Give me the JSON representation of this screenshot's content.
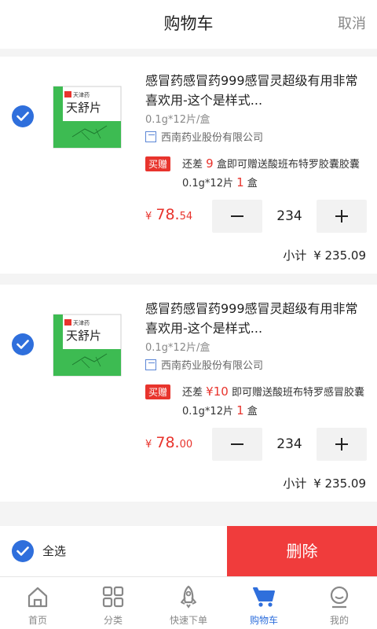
{
  "header": {
    "title": "购物车",
    "cancel": "取消"
  },
  "items": [
    {
      "name": "感冒药感冒药999感冒灵超级有用非常喜欢用-这个是样式...",
      "spec": "0.1g*12片/盒",
      "maker": "西南药业股份有限公司",
      "promo_tag": "买赠",
      "promo_pre": "还差",
      "promo_amount": "9",
      "promo_mid": "盒即可赠送酸班布特罗胶囊胶囊",
      "promo_spec": "0.1g*12片",
      "promo_count": "1",
      "promo_unit": "盒",
      "price_currency": "¥",
      "price_int": "78.",
      "price_dec": "54",
      "quantity": "234",
      "subtotal_label": "小计",
      "subtotal_value": "¥ 235.09",
      "box_brand": "天舒片",
      "box_logo": "天津药"
    },
    {
      "name": "感冒药感冒药999感冒灵超级有用非常喜欢用-这个是样式...",
      "spec": "0.1g*12片/盒",
      "maker": "西南药业股份有限公司",
      "promo_tag": "买赠",
      "promo_pre": "还差",
      "promo_amount": "¥10",
      "promo_mid": "即可赠送酸班布特罗感冒胶囊",
      "promo_spec": "0.1g*12片",
      "promo_count": "1",
      "promo_unit": "盒",
      "price_currency": "¥",
      "price_int": "78.",
      "price_dec": "00",
      "quantity": "234",
      "subtotal_label": "小计",
      "subtotal_value": "¥ 235.09",
      "box_brand": "天舒片",
      "box_logo": "天津药"
    }
  ],
  "bottom": {
    "select_all": "全选",
    "delete": "删除"
  },
  "tabs": [
    {
      "label": "首页",
      "icon": "home-icon"
    },
    {
      "label": "分类",
      "icon": "grid-icon"
    },
    {
      "label": "快速下单",
      "icon": "rocket-icon"
    },
    {
      "label": "购物车",
      "icon": "cart-icon",
      "active": true
    },
    {
      "label": "我的",
      "icon": "profile-icon"
    }
  ],
  "colors": {
    "accent": "#2f6fdc",
    "price": "#e8342d",
    "delete": "#f03c3c"
  }
}
